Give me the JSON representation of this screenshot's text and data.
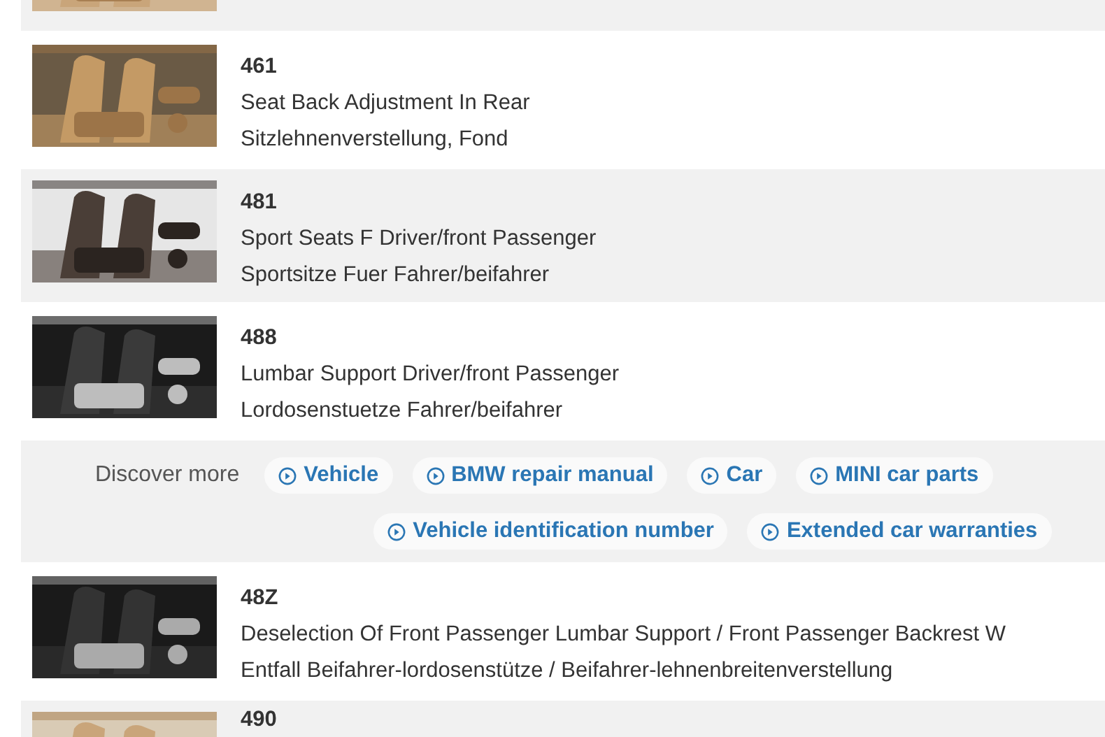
{
  "rows": [
    {
      "kind": "part"
    },
    {
      "kind": "part",
      "code": "461",
      "lines": [
        "Seat Back Adjustment In Rear",
        "Sitzlehnenverstellung, Fond"
      ]
    },
    {
      "kind": "part",
      "code": "481",
      "lines": [
        "Sport Seats F Driver/front Passenger",
        "Sportsitze Fuer Fahrer/beifahrer"
      ]
    },
    {
      "kind": "part",
      "code": "488",
      "lines": [
        "Lumbar Support Driver/front Passenger",
        "Lordosenstuetze Fahrer/beifahrer"
      ]
    },
    {
      "kind": "discover",
      "label": "Discover more",
      "chip_lines": [
        [
          "Vehicle",
          "BMW repair manual",
          "Car",
          "MINI car parts"
        ],
        [
          "Vehicle identification number",
          "Extended car warranties"
        ]
      ]
    },
    {
      "kind": "part",
      "code": "48Z",
      "lines": [
        "Deselection Of Front Passenger Lumbar Support / Front Passenger Backrest W",
        "Entfall Beifahrer-lordosenstütze / Beifahrer-lehnenbreitenverstellung"
      ]
    },
    {
      "kind": "part",
      "code": "490"
    }
  ]
}
